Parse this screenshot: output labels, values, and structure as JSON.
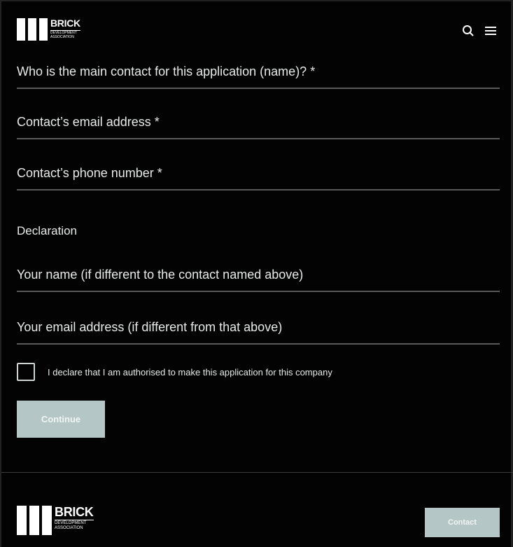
{
  "brand": {
    "name": "BRICK",
    "sub_line1": "DEVELOPMENT",
    "sub_line2": "ASSOCIATION"
  },
  "header": {
    "icons": [
      "search-icon",
      "menu-icon"
    ]
  },
  "form": {
    "fields": [
      {
        "label": "Who is the main contact for this application (name)? *"
      },
      {
        "label": "Contact’s email address *"
      },
      {
        "label": "Contact’s phone number *"
      },
      {
        "label": "Your name (if different to the contact named above)"
      },
      {
        "label": "Your email address (if different from that above)"
      }
    ],
    "declaration_title": "Declaration",
    "checkbox_label": "I declare that I am authorised to make this application for this company",
    "continue_label": "Continue"
  },
  "footer": {
    "contact_label": "Contact"
  },
  "colors": {
    "background": "#030303",
    "button": "#b4c6c5",
    "underline": "#5a5a5a"
  }
}
